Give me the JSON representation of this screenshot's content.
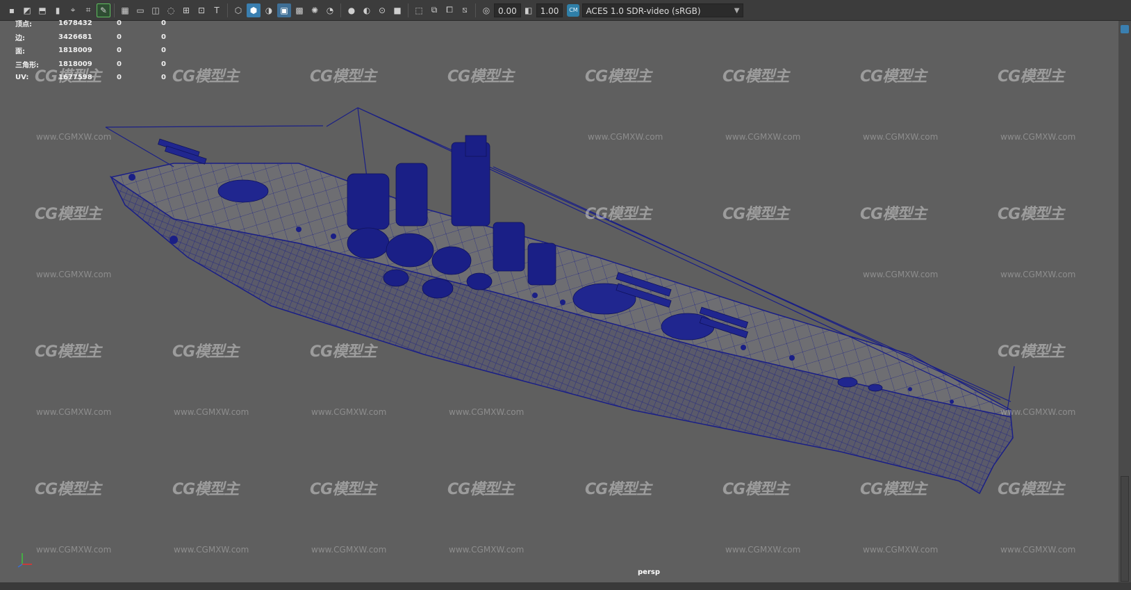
{
  "toolbar": {
    "exposure_value": "0.00",
    "gamma_value": "1.00",
    "color_space": "ACES 1.0 SDR-video (sRGB)"
  },
  "hud": {
    "rows": [
      {
        "label": "顶点:",
        "v1": "1678432",
        "v2": "0",
        "v3": "0"
      },
      {
        "label": "边:",
        "v1": "3426681",
        "v2": "0",
        "v3": "0"
      },
      {
        "label": "面:",
        "v1": "1818009",
        "v2": "0",
        "v3": "0"
      },
      {
        "label": "三角形:",
        "v1": "1818009",
        "v2": "0",
        "v3": "0"
      },
      {
        "label": "UV:",
        "v1": "1677598",
        "v2": "0",
        "v3": "0"
      }
    ]
  },
  "viewport": {
    "camera_label": "persp",
    "wireframe_color": "#1a1f86",
    "background_color": "#5f5f5f"
  },
  "watermark": {
    "logo_text": "CG模型主",
    "url_text": "www.CGMXW.com"
  },
  "icons": [
    "select-icon",
    "move-icon",
    "rotate-icon",
    "scale-icon",
    "camera-icon",
    "grid-icon",
    "cube-icon",
    "light-icon",
    "shadow-icon",
    "aces-icon",
    "chevron-down-icon"
  ]
}
